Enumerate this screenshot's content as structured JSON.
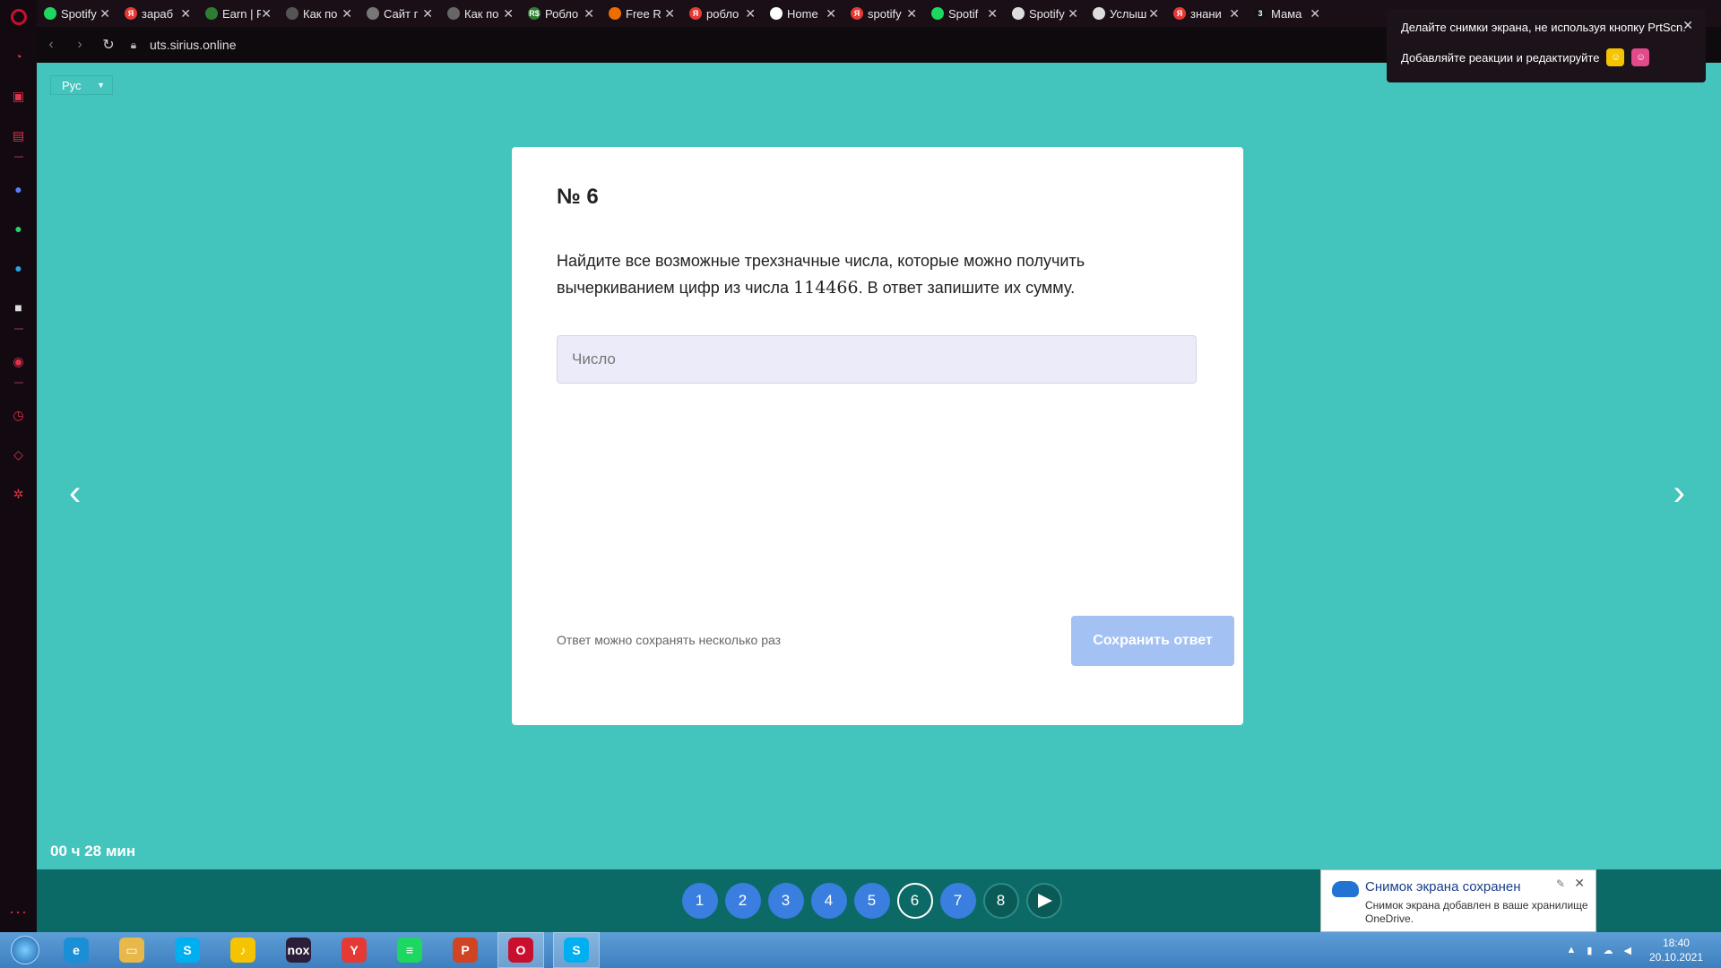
{
  "browser": {
    "tabs": [
      {
        "title": "Spotify",
        "color": "#1ed760",
        "glyph": ""
      },
      {
        "title": "зараб",
        "color": "#e53935",
        "glyph": "Я"
      },
      {
        "title": "Earn | F",
        "color": "#2e7d32",
        "glyph": ""
      },
      {
        "title": "Как по",
        "color": "#555555",
        "glyph": ""
      },
      {
        "title": "Сайт г",
        "color": "#777777",
        "glyph": ""
      },
      {
        "title": "Как по",
        "color": "#666666",
        "glyph": ""
      },
      {
        "title": "Робло",
        "color": "#2e7d32",
        "glyph": "R$"
      },
      {
        "title": "Free R",
        "color": "#ef6c00",
        "glyph": ""
      },
      {
        "title": "робло",
        "color": "#e53935",
        "glyph": "Я"
      },
      {
        "title": "Home",
        "color": "#ffffff",
        "glyph": ""
      },
      {
        "title": "spotify",
        "color": "#e53935",
        "glyph": "Я"
      },
      {
        "title": "Spotif",
        "color": "#1ed760",
        "glyph": ""
      },
      {
        "title": "Spotify",
        "color": "#dddddd",
        "glyph": ""
      },
      {
        "title": "Услыш",
        "color": "#dddddd",
        "glyph": ""
      },
      {
        "title": "знани",
        "color": "#e53935",
        "glyph": "Я"
      },
      {
        "title": "Мама",
        "color": "#111111",
        "glyph": "3"
      }
    ],
    "tab_close": "✕",
    "url": "uts.sirius.online"
  },
  "page": {
    "language": "Рус",
    "question_number": "№ 6",
    "question_text_before": "Найдите все возможные трехзначные числа, которые можно получить вычеркиванием цифр из числа ",
    "question_number_value": "114466",
    "question_text_after": ". В ответ запишите их сумму.",
    "answer_placeholder": "Число",
    "answer_value": "",
    "hint": "Ответ можно сохранять несколько раз",
    "save_label": "Сохранить ответ",
    "timer": "00 ч 28 мин",
    "questions": [
      "1",
      "2",
      "3",
      "4",
      "5",
      "6",
      "7",
      "8"
    ],
    "current_question": "6",
    "accent_color": "#43c4bd",
    "button_color": "#3a7ee0"
  },
  "popup": {
    "line1": "Делайте снимки экрана, не используя кнопку PrtScn.",
    "line2": "Добавляйте реакции и редактируйте",
    "close": "✕"
  },
  "toast": {
    "title": "Снимок экрана сохранен",
    "body": "Снимок экрана добавлен в ваше хранилище OneDrive."
  },
  "taskbar": {
    "apps": [
      {
        "name": "edge",
        "color": "#1a8fd6",
        "glyph": "e"
      },
      {
        "name": "explorer",
        "color": "#e8b84a",
        "glyph": "▭"
      },
      {
        "name": "skype",
        "color": "#00aff0",
        "glyph": "S"
      },
      {
        "name": "app-yellow",
        "color": "#f5c400",
        "glyph": "♪"
      },
      {
        "name": "nox",
        "color": "#2a1e3a",
        "glyph": "nox"
      },
      {
        "name": "yandex",
        "color": "#e53935",
        "glyph": "Y"
      },
      {
        "name": "spotify",
        "color": "#1ed760",
        "glyph": "≡"
      },
      {
        "name": "powerpoint",
        "color": "#d04423",
        "glyph": "P"
      },
      {
        "name": "opera",
        "color": "#c8102e",
        "glyph": "O"
      },
      {
        "name": "skype-active",
        "color": "#00aff0",
        "glyph": "S"
      }
    ],
    "time": "18:40",
    "date": "20.10.2021"
  }
}
